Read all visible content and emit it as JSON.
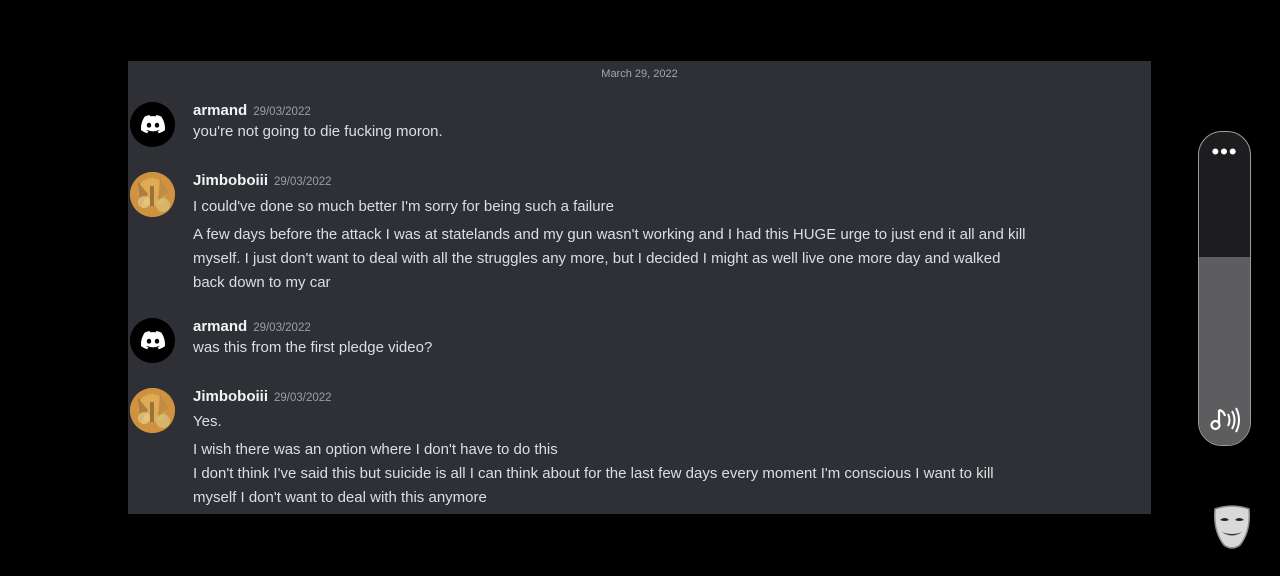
{
  "date_divider": "March 29, 2022",
  "messages": [
    {
      "username": "armand",
      "timestamp": "29/03/2022",
      "avatar": "discord-logo-icon",
      "lines": [
        "you're not going to die fucking moron."
      ]
    },
    {
      "username": "Jimboboiii",
      "timestamp": "29/03/2022",
      "avatar": "user-avatar-image",
      "lines": [
        "I could've done so much better I'm sorry for being such a failure",
        "A few days before the attack I was at statelands and my gun wasn't working and I had this HUGE urge to just end it all and kill",
        "myself. I just don't want to deal with all the struggles any more, but I decided I might as well live one more day and walked",
        "back down to my car"
      ]
    },
    {
      "username": "armand",
      "timestamp": "29/03/2022",
      "avatar": "discord-logo-icon",
      "lines": [
        "was this from the first pledge video?"
      ]
    },
    {
      "username": "Jimboboiii",
      "timestamp": "29/03/2022",
      "avatar": "user-avatar-image",
      "lines": [
        "Yes.",
        "I wish there was an option where I don't have to do this",
        "I don't think I've said this but suicide is all I can think about for the last few days every moment I'm conscious I want to kill",
        "myself I don't want to deal with this anymore"
      ]
    }
  ],
  "side_panel": {
    "more_label": "•••",
    "more_icon": "more-options-icon",
    "media_icon": "music-volume-icon",
    "volume_level": 0.6
  },
  "watermark_icon": "mask-logo-icon",
  "colors": {
    "background": "#000000",
    "chat_bg": "#2e3035",
    "username": "#f2f3f5",
    "message_text": "#dcdee1",
    "timestamp": "#9a9ea4"
  }
}
